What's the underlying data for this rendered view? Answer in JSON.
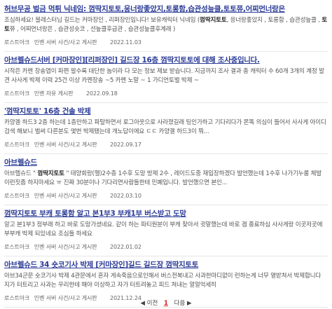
{
  "results": [
    {
      "title": "허브무공 벌금 먹튀 닉네임: 껌딱지토토,응너랑좋았지,토롱함,습관성늪클,토토쮸,어찌먼너랑은",
      "snippet_parts": [
        {
          "t": "조심하세요! 블레스터님 길드는 커마장인 , 리퍼장인입니다! 보유캐릭터 닉네임 ("
        },
        {
          "t": "껌딱지토토",
          "b": true
        },
        {
          "t": ", 응너랑좋았지 , 토롱함 , 습관성늪클 , "
        },
        {
          "t": "토토",
          "b": true
        },
        {
          "t": "쮸 , 어찌먼너랑은 , 습관성숏코 , 선늪클후급관 , 습관성늪클후계래 )"
        }
      ],
      "meta": {
        "source": "로스트아크",
        "board": "인벤 서버 사건/사고 게시판",
        "date": "2022.11.03"
      }
    },
    {
      "title": "아브렐슈드서버 [커마장인][리퍼장인] 길드장 16층 껌딱지토토에 대해 조사중입니다.",
      "snippet_parts": [
        {
          "t": "시작은 카멘 장송엽이 파편 팔수록 대단한 놈이라 다 모는 정보 제보 받습니다. 지금까지 조사 결과 총 캐릭터 수 60개 3개의 계정 발견 사사게 박제 이력 25건 이상 카멘장송 ~5 카멘 노말 ~ 1 가디언토벌 박제 ~"
        }
      ],
      "meta": {
        "source": "로스트아크",
        "board": "인벤 자유 게시판",
        "date": "2022.09.18"
      }
    },
    {
      "title": "'껌딱지토토' 16층 건솔 박제",
      "snippet_parts": [
        {
          "t": "카양겔 하드3 2층 하는데 1층만하고 파탈하면서 로그아웃으로 사라졌길래 팅인가하고 기다리다가 몬똑 의심이 들어서 사사게 아이디검색 해보니 벌써 다른분도 몇번 박제됐는데 개노답이에요 ㄷㄷ 카양겔 하드3이 뭐..."
        }
      ],
      "meta": {
        "source": "로스트아크",
        "board": "인벤 서버 사건/사고 게시판",
        "date": "2022.09.17"
      }
    },
    {
      "title": "아브렐슈드",
      "snippet_parts": [
        {
          "t": "아브렐슈드 \" "
        },
        {
          "t": "껌딱지토토",
          "b": true
        },
        {
          "t": " \" 태양회랑(헬)2수층 1수후 도망 방제 2수 , 레이드도중 재입장하겠다 발언했는데 1수후 나가기누룸 체발 이런짓좀 하지마세요 ㅠ 진짜 30분이나 기다리면사람들한테 민폐입니다. 발언했으면 본인..."
        }
      ],
      "meta": {
        "source": "로스트아크",
        "board": "인벤 서버 사건/사고 게시판",
        "date": "2022.03.10"
      }
    },
    {
      "title": "껌딱지토토 부캐 토롱함 알고 본1부3 부캐1부 버스받고 도망",
      "snippet_parts": [
        {
          "t": "알고 본1부3 정부래 하고 바로 도망가셨네요. 같이 하는 파티원분이 부캐 찾아서 귓말했는데 바로 겜 종료하심 사사게랑 이곳저곳에 부부캐 박제 되있네요 조심들 하세요"
        }
      ],
      "meta": {
        "source": "로스트아크",
        "board": "인벤 서버 사건/사고 게시판",
        "date": "2022.01.02"
      }
    },
    {
      "title": "아브렐슈드 34 숏코기사 박제 [커마장인]길드 길드장 껌딱지토토",
      "snippet_parts": [
        {
          "t": "아브34군문 숏코기사 박제 4관문에서 혼자 게속죽음으로인해서 버스전복내고 사과한마디없이 런하는게 너무 열받쳐서 박제합니다 지가 터트리고 사과는 우리한테 해야 이상하고 자가 터트려놓고 피드 쳐내는 얼얼억세히"
        }
      ],
      "meta": {
        "source": "로스트아크",
        "board": "인벤 서버 사건/사고 게시판",
        "date": "2021.12.24"
      }
    }
  ],
  "pagination": {
    "prev": "◀ 이전",
    "current": "1",
    "next": "다음 ▶"
  }
}
